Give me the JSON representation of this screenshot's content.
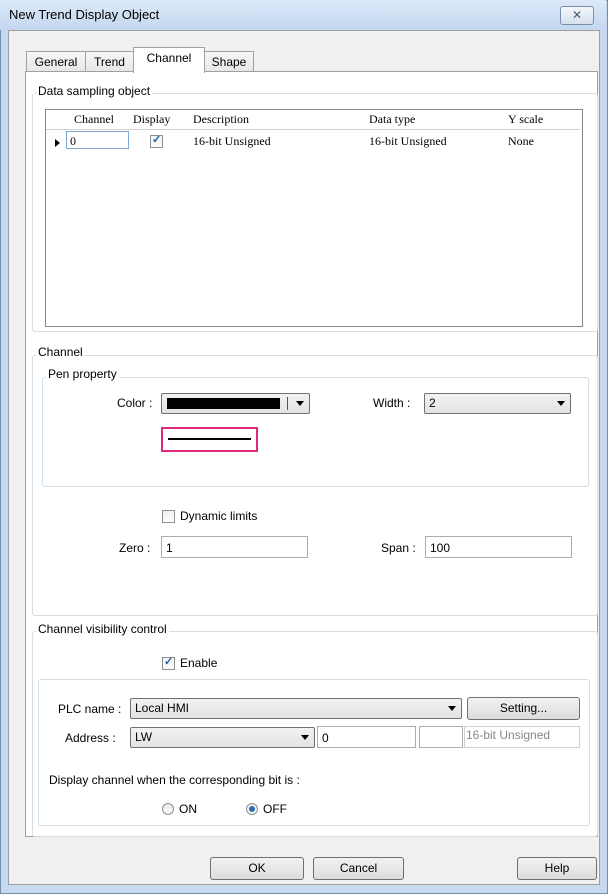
{
  "window": {
    "title": "New Trend Display Object",
    "close_glyph": "✕"
  },
  "tabs": [
    {
      "label": "General"
    },
    {
      "label": "Trend"
    },
    {
      "label": "Channel"
    },
    {
      "label": "Shape"
    }
  ],
  "sampling": {
    "group_label": "Data sampling object",
    "columns": [
      "Channel",
      "Display",
      "Description",
      "Data type",
      "Y scale"
    ],
    "rows": [
      {
        "channel": "0",
        "display": true,
        "description": "16-bit Unsigned",
        "data_type": "16-bit Unsigned",
        "y_scale": "None"
      }
    ]
  },
  "channel": {
    "group_label": "Channel",
    "pen_label": "Pen property",
    "color_label": "Color :",
    "color_value": "#000000",
    "width_label": "Width :",
    "width_value": "2",
    "dynamic_limits_label": "Dynamic limits",
    "dynamic_limits_checked": false,
    "zero_label": "Zero :",
    "zero_value": "1",
    "span_label": "Span :",
    "span_value": "100"
  },
  "visibility": {
    "group_label": "Channel visibility control",
    "enable_label": "Enable",
    "enable_checked": true,
    "plc_label": "PLC name :",
    "plc_value": "Local HMI",
    "setting_label": "Setting...",
    "address_label": "Address :",
    "address_device": "LW",
    "address_value": "0",
    "address_type": "16-bit Unsigned",
    "condition_label": "Display channel when the corresponding bit is :",
    "on_label": "ON",
    "off_label": "OFF",
    "selected": "OFF"
  },
  "footer": {
    "ok_label": "OK",
    "cancel_label": "Cancel",
    "help_label": "Help"
  }
}
